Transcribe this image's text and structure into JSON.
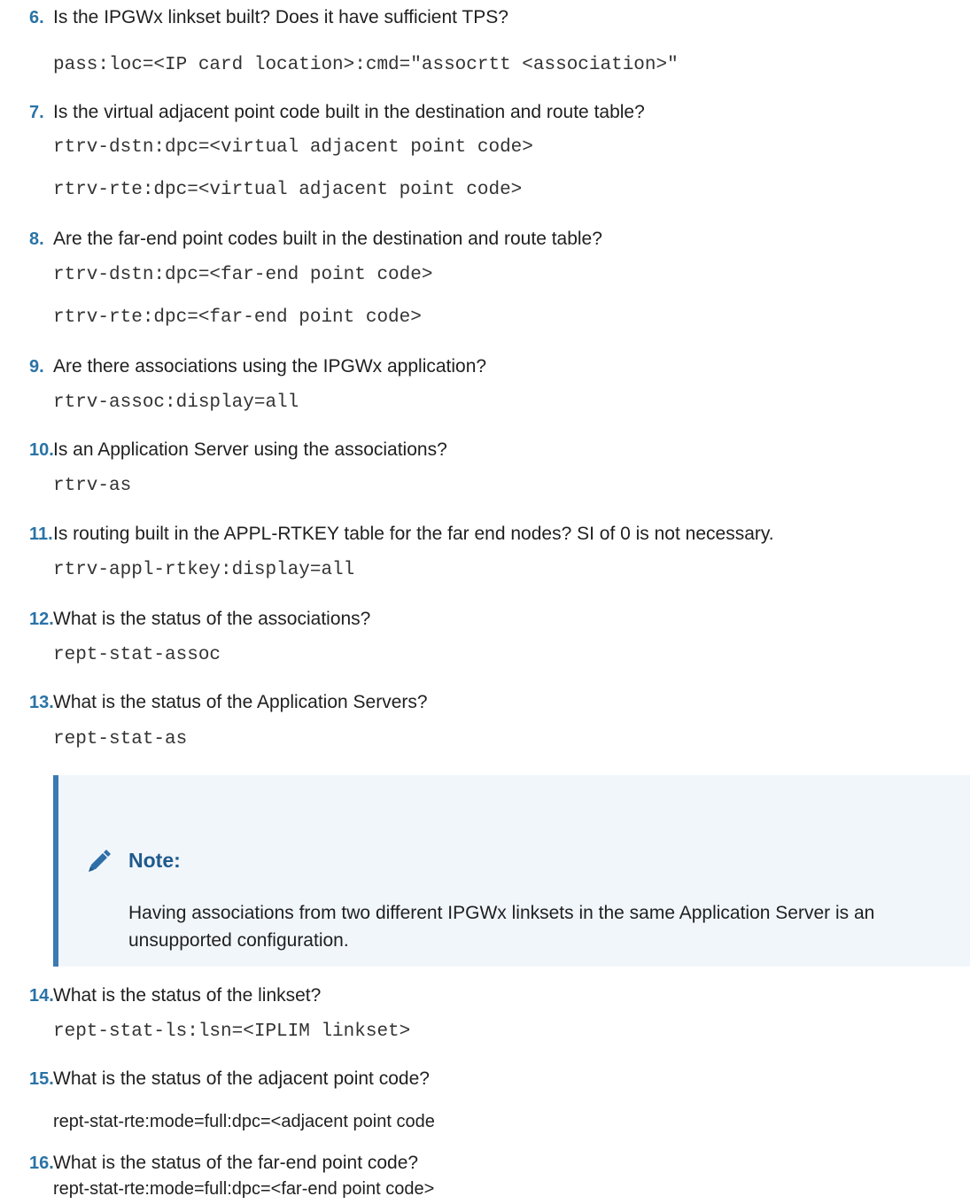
{
  "steps": [
    {
      "num": "6.",
      "question": "Is the IPGWx linkset built? Does it have sufficient TPS?",
      "commands": [
        "pass:loc=<IP card location>:cmd=\"assocrtt <association>\""
      ]
    },
    {
      "num": "7.",
      "question": "Is the virtual adjacent point code built in the destination and route table?",
      "commands": [
        "rtrv-dstn:dpc=<virtual adjacent point code>",
        "rtrv-rte:dpc=<virtual adjacent point code>"
      ]
    },
    {
      "num": "8.",
      "question": "Are the far-end point codes built in the destination and route table?",
      "commands": [
        "rtrv-dstn:dpc=<far-end point code>",
        "rtrv-rte:dpc=<far-end point code>"
      ]
    },
    {
      "num": "9.",
      "question": "Are there associations using the IPGWx application?",
      "commands": [
        "rtrv-assoc:display=all"
      ]
    },
    {
      "num": "10.",
      "question": "Is an Application Server using the associations?",
      "commands": [
        "rtrv-as"
      ]
    },
    {
      "num": "11.",
      "question": "Is routing built in the APPL-RTKEY table for the far end nodes? SI of 0 is not necessary.",
      "commands": [
        "rtrv-appl-rtkey:display=all"
      ]
    },
    {
      "num": "12.",
      "question": "What is the status of the associations?",
      "commands": [
        "rept-stat-assoc"
      ]
    },
    {
      "num": "13.",
      "question": "What is the status of the Application Servers?",
      "commands": [
        "rept-stat-as"
      ]
    },
    {
      "num": "14.",
      "question": "What is the status of the linkset?",
      "commands": [
        "rept-stat-ls:lsn=<IPLIM linkset>"
      ]
    },
    {
      "num": "15.",
      "question": "What is the status of the adjacent point code?",
      "commands": [
        "rept-stat-rte:mode=full:dpc=<adjacent point code"
      ]
    },
    {
      "num": "16.",
      "question": "What is the status of the far-end point code?",
      "commands": [
        "rept-stat-rte:mode=full:dpc=<far-end point code>"
      ]
    }
  ],
  "note": {
    "icon": "pencil-icon",
    "title": "Note:",
    "text": "Having associations from two different IPGWx linksets in the same Application Server is an unsupported configuration."
  },
  "colors": {
    "step_number": "#2a73a6",
    "note_border": "#3b7ab3",
    "note_background": "#f1f6fb",
    "note_title": "#1f5a8c"
  }
}
